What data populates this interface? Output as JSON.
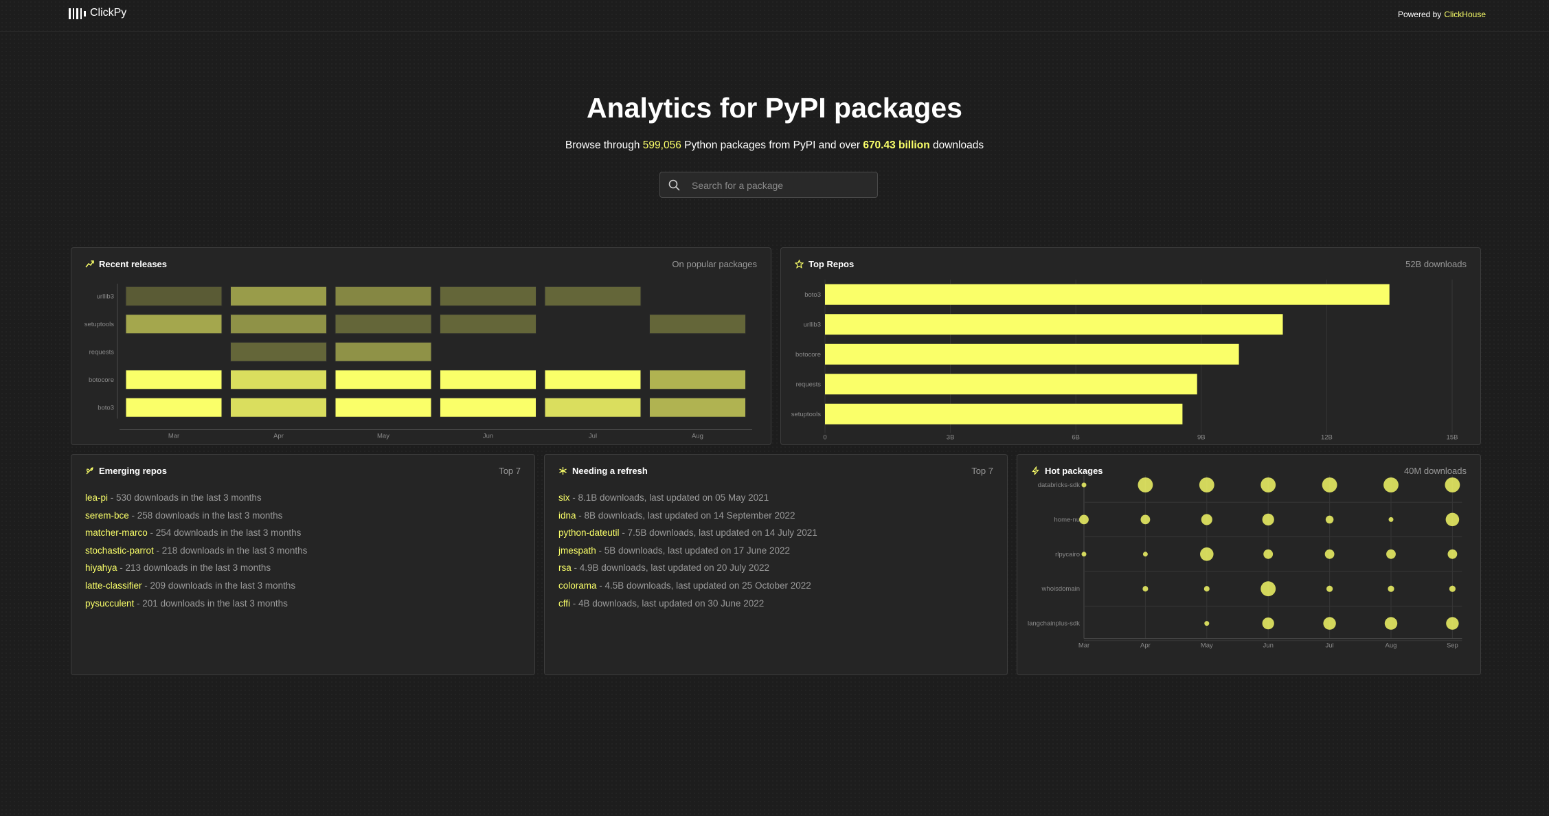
{
  "header": {
    "logo_text": "ClickPy",
    "powered_by": "Powered by",
    "powered_brand": "ClickHouse"
  },
  "hero": {
    "title": "Analytics for PyPI packages",
    "sub_prefix": "Browse through ",
    "package_count": "599,056",
    "sub_middle": " Python packages from PyPI and over ",
    "download_total": "670.43 billion",
    "sub_suffix": " downloads"
  },
  "search": {
    "placeholder": "Search for a package",
    "value": ""
  },
  "colors": {
    "accent": "#faff69",
    "background": "#1d1d1d",
    "card": "#252525",
    "border": "#3d3d3d"
  },
  "cards": {
    "recent_releases": {
      "title": "Recent releases",
      "meta": "On popular packages",
      "icon": "trend-icon"
    },
    "top_repos": {
      "title": "Top Repos",
      "meta": "52B downloads",
      "icon": "star-icon"
    },
    "emerging": {
      "title": "Emerging repos",
      "meta": "Top 7",
      "icon": "sprout-icon"
    },
    "refresh": {
      "title": "Needing a refresh",
      "meta": "Top 7",
      "icon": "asterisk-icon"
    },
    "hot": {
      "title": "Hot packages",
      "meta": "40M downloads",
      "icon": "bolt-icon"
    }
  },
  "emerging_list": [
    {
      "name": "lea-pi",
      "desc": " - 530 downloads in the last 3 months"
    },
    {
      "name": "serem-bce",
      "desc": " - 258 downloads in the last 3 months"
    },
    {
      "name": "matcher-marco",
      "desc": " - 254 downloads in the last 3 months"
    },
    {
      "name": "stochastic-parrot",
      "desc": " - 218 downloads in the last 3 months"
    },
    {
      "name": "hiyahya",
      "desc": " - 213 downloads in the last 3 months"
    },
    {
      "name": "latte-classifier",
      "desc": " - 209 downloads in the last 3 months"
    },
    {
      "name": "pysucculent",
      "desc": " - 201 downloads in the last 3 months"
    }
  ],
  "refresh_list": [
    {
      "name": "six",
      "desc": " - 8.1B downloads, last updated on 05 May 2021"
    },
    {
      "name": "idna",
      "desc": " - 8B downloads, last updated on 14 September 2022"
    },
    {
      "name": "python-dateutil",
      "desc": " - 7.5B downloads, last updated on 14 July 2021"
    },
    {
      "name": "jmespath",
      "desc": " - 5B downloads, last updated on 17 June 2022"
    },
    {
      "name": "rsa",
      "desc": " - 4.9B downloads, last updated on 20 July 2022"
    },
    {
      "name": "colorama",
      "desc": " - 4.5B downloads, last updated on 25 October 2022"
    },
    {
      "name": "cffi",
      "desc": " - 4B downloads, last updated on 30 June 2022"
    }
  ],
  "chart_data": [
    {
      "id": "recent_releases",
      "type": "heatmap",
      "x": [
        "Mar",
        "Apr",
        "May",
        "Jun",
        "Jul",
        "Aug"
      ],
      "y": [
        "urllib3",
        "setuptools",
        "requests",
        "botocore",
        "boto3"
      ],
      "values": [
        [
          0.25,
          0.55,
          0.45,
          0.3,
          0.3,
          null
        ],
        [
          0.6,
          0.5,
          0.3,
          0.3,
          null,
          0.3
        ],
        [
          null,
          0.3,
          0.5,
          null,
          null,
          null
        ],
        [
          1.0,
          0.85,
          1.0,
          1.0,
          1.0,
          0.65
        ],
        [
          1.0,
          0.85,
          1.0,
          1.0,
          0.85,
          0.65
        ]
      ]
    },
    {
      "id": "top_repos",
      "type": "bar",
      "categories": [
        "boto3",
        "urllib3",
        "botocore",
        "requests",
        "setuptools"
      ],
      "values": [
        13.5,
        10.95,
        9.9,
        8.9,
        8.55
      ],
      "xticks": [
        "0",
        "3B",
        "6B",
        "9B",
        "12B",
        "15B"
      ],
      "xlim": [
        0,
        15
      ]
    },
    {
      "id": "hot_packages",
      "type": "scatter",
      "x": [
        "Mar",
        "Apr",
        "May",
        "Jun",
        "Jul",
        "Aug",
        "Sep"
      ],
      "y": [
        "databricks-sdk",
        "home-nu",
        "rlpycairo",
        "whoisdomain",
        "langchainplus-sdk"
      ],
      "sizes": [
        [
          0.3,
          0.95,
          0.95,
          0.95,
          0.95,
          0.95,
          0.95
        ],
        [
          0.6,
          0.6,
          0.7,
          0.75,
          0.5,
          0.3,
          0.85
        ],
        [
          0.3,
          0.3,
          0.85,
          0.6,
          0.6,
          0.6,
          0.6
        ],
        [
          null,
          0.35,
          0.35,
          0.95,
          0.4,
          0.4,
          0.4
        ],
        [
          null,
          null,
          0.3,
          0.75,
          0.8,
          0.8,
          0.8
        ]
      ]
    }
  ]
}
